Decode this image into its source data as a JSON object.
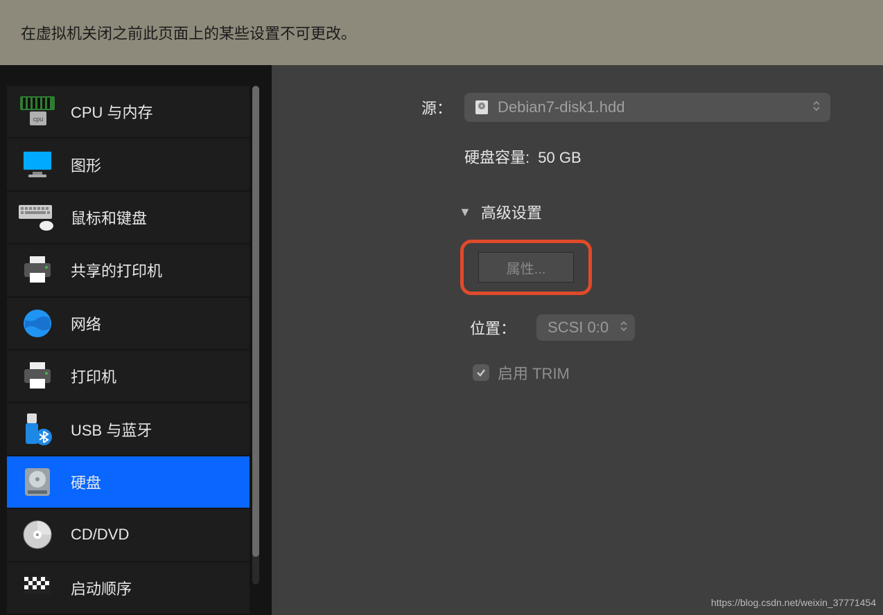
{
  "banner": {
    "text": "在虚拟机关闭之前此页面上的某些设置不可更改。"
  },
  "sidebar": {
    "items": [
      {
        "label": "CPU 与内存"
      },
      {
        "label": "图形"
      },
      {
        "label": "鼠标和键盘"
      },
      {
        "label": "共享的打印机"
      },
      {
        "label": "网络"
      },
      {
        "label": "打印机"
      },
      {
        "label": "USB 与蓝牙"
      },
      {
        "label": "硬盘"
      },
      {
        "label": "CD/DVD"
      },
      {
        "label": "启动顺序"
      }
    ]
  },
  "main": {
    "source_label": "源：",
    "source_value": "Debian7-disk1.hdd",
    "capacity_label": "硬盘容量:",
    "capacity_value": "50 GB",
    "advanced_label": "高级设置",
    "properties_button": "属性...",
    "location_label": "位置：",
    "location_value": "SCSI 0:0",
    "trim_label": "启用 TRIM"
  },
  "watermark": "https://blog.csdn.net/weixin_37771454"
}
